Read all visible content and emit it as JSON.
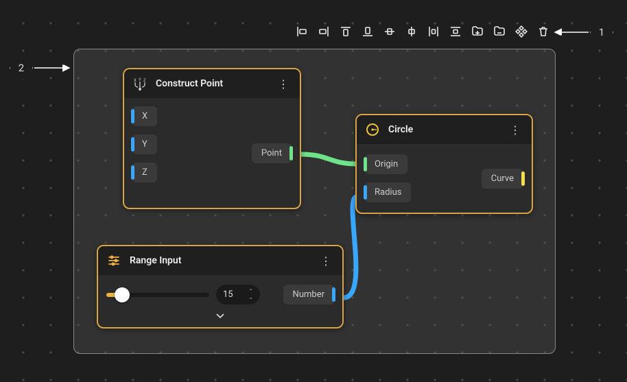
{
  "toolbar": {
    "items": [
      "align-left",
      "align-right",
      "align-top",
      "align-bottom",
      "align-center-h",
      "align-center-v",
      "distribute-h",
      "distribute-v",
      "group",
      "ungroup",
      "arrange",
      "delete"
    ]
  },
  "callouts": {
    "one": "1",
    "two": "2"
  },
  "nodes": {
    "construct": {
      "title": "Construct Point",
      "inputs": {
        "x": "X",
        "y": "Y",
        "z": "Z"
      },
      "outputs": {
        "point": "Point"
      }
    },
    "circle": {
      "title": "Circle",
      "inputs": {
        "origin": "Origin",
        "radius": "Radius"
      },
      "outputs": {
        "curve": "Curve"
      }
    },
    "range": {
      "title": "Range Input",
      "value": "15",
      "outputs": {
        "number": "Number"
      }
    }
  }
}
